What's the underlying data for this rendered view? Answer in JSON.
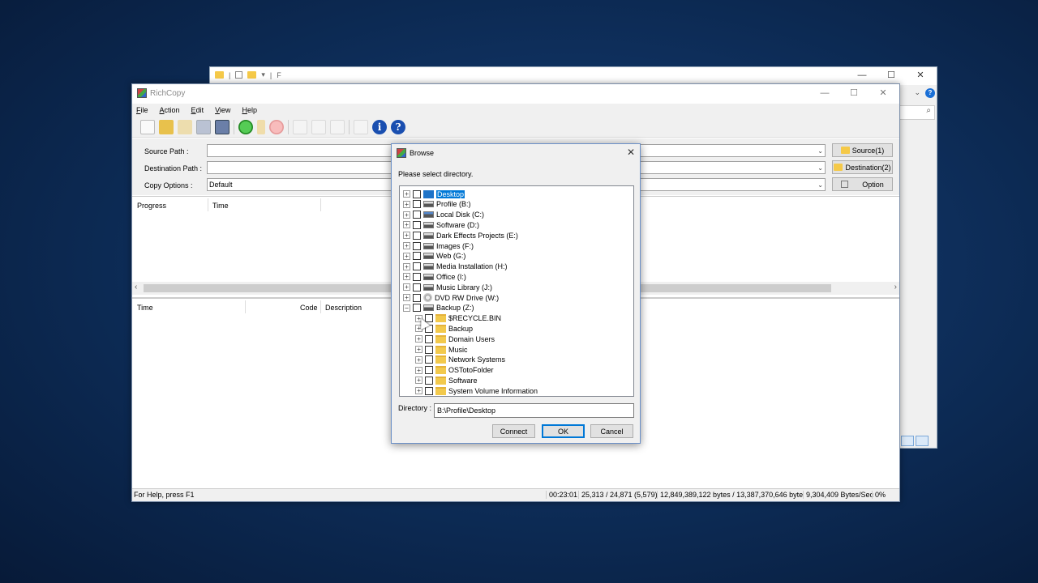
{
  "explorer": {
    "title_fragment": "F",
    "controls": {
      "minimize": "—",
      "maximize": "☐",
      "close": "✕"
    },
    "help": "?",
    "chevron": "⌄",
    "search_icon": "search-icon"
  },
  "richcopy": {
    "title": "RichCopy",
    "controls": {
      "minimize": "—",
      "maximize": "☐",
      "close": "✕"
    },
    "menu": [
      "File",
      "Action",
      "Edit",
      "View",
      "Help"
    ],
    "form": {
      "source_label": "Source Path :",
      "source_value": "",
      "destination_label": "Destination Path :",
      "destination_value": "",
      "copy_options_label": "Copy Options :",
      "copy_options_value": "Default",
      "source_button": "Source(1)",
      "destination_button": "Destination(2)",
      "option_button": "Option"
    },
    "progress_columns": {
      "progress": "Progress",
      "time": "Time"
    },
    "log_columns": {
      "time": "Time",
      "code": "Code",
      "description": "Description"
    },
    "status": {
      "help": "For Help, press F1",
      "elapsed": "00:23:01",
      "files": "25,313 / 24,871 (5,579)",
      "bytes": "12,849,389,122 bytes / 13,387,370,646 bytes",
      "rate": "9,304,409 Bytes/Sec",
      "percent": "0%"
    }
  },
  "browse": {
    "title": "Browse",
    "close": "✕",
    "prompt": "Please select directory.",
    "tree": [
      {
        "label": "Desktop",
        "icon": "desktop",
        "level": 0,
        "exp": "+",
        "selected": true
      },
      {
        "label": "Profile (B:)",
        "icon": "drive",
        "level": 0,
        "exp": "+"
      },
      {
        "label": "Local Disk (C:)",
        "icon": "cdrive",
        "level": 0,
        "exp": "+"
      },
      {
        "label": "Software (D:)",
        "icon": "drive",
        "level": 0,
        "exp": "+"
      },
      {
        "label": "Dark Effects Projects (E:)",
        "icon": "drive",
        "level": 0,
        "exp": "+"
      },
      {
        "label": "Images (F:)",
        "icon": "drive",
        "level": 0,
        "exp": "+"
      },
      {
        "label": "Web (G:)",
        "icon": "drive",
        "level": 0,
        "exp": "+"
      },
      {
        "label": "Media Installation (H:)",
        "icon": "drive",
        "level": 0,
        "exp": "+"
      },
      {
        "label": "Office (I:)",
        "icon": "drive",
        "level": 0,
        "exp": "+"
      },
      {
        "label": "Music Library (J:)",
        "icon": "drive",
        "level": 0,
        "exp": "+"
      },
      {
        "label": "DVD RW Drive (W:)",
        "icon": "disc",
        "level": 0,
        "exp": "+"
      },
      {
        "label": "Backup (Z:)",
        "icon": "drive",
        "level": 0,
        "exp": "−"
      },
      {
        "label": "$RECYCLE.BIN",
        "icon": "folder",
        "level": 1,
        "exp": "+"
      },
      {
        "label": "Backup",
        "icon": "folder",
        "level": 1,
        "exp": "+"
      },
      {
        "label": "Domain Users",
        "icon": "folder",
        "level": 1,
        "exp": "+"
      },
      {
        "label": "Music",
        "icon": "folder",
        "level": 1,
        "exp": "+"
      },
      {
        "label": "Network Systems",
        "icon": "folder",
        "level": 1,
        "exp": "+"
      },
      {
        "label": "OSTotoFolder",
        "icon": "folder",
        "level": 1,
        "exp": "+"
      },
      {
        "label": "Software",
        "icon": "folder",
        "level": 1,
        "exp": "+"
      },
      {
        "label": "System Volume Information",
        "icon": "folder",
        "level": 1,
        "exp": "+"
      }
    ],
    "directory_label": "Directory :",
    "directory_value": "B:\\Profile\\Desktop",
    "buttons": {
      "connect": "Connect",
      "ok": "OK",
      "cancel": "Cancel"
    }
  }
}
